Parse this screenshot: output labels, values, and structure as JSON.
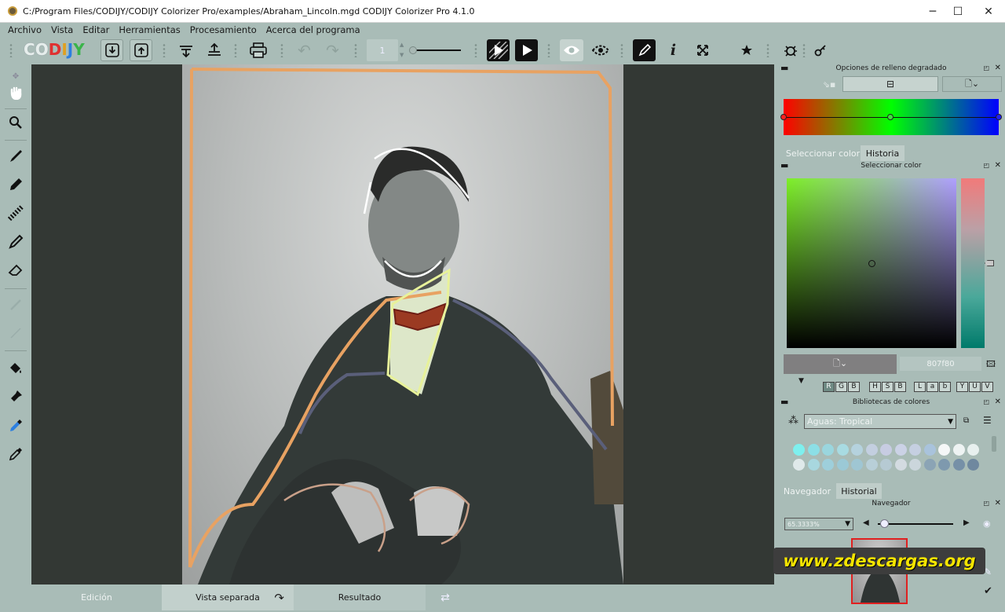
{
  "window": {
    "title": "C:/Program Files/CODIJY/CODIJY Colorizer Pro/examples/Abraham_Lincoln.mgd CODIJY Colorizer Pro 4.1.0",
    "minimize": "─",
    "maximize": "☐",
    "close": "✕"
  },
  "menu": [
    "Archivo",
    "Vista",
    "Editar",
    "Herramientas",
    "Procesamiento",
    "Acerca del programa"
  ],
  "toolbar": {
    "logo": [
      "C",
      "O",
      "D",
      "I",
      "J",
      "Y"
    ],
    "page_number": "1"
  },
  "bottom": {
    "edit": "Edición",
    "split": "Vista separada",
    "result": "Resultado"
  },
  "gradient_panel": {
    "title": "Opciones de relleno degradado"
  },
  "color_panel": {
    "tabs": [
      "Seleccionar color",
      "Historia"
    ],
    "title": "Seleccionar color",
    "hex": "807f80",
    "rgb": [
      "R",
      "G",
      "B"
    ],
    "hsb": [
      "H",
      "S",
      "B"
    ],
    "lab": [
      "L",
      "a",
      "b"
    ],
    "yuv": [
      "Y",
      "U",
      "V"
    ]
  },
  "libraries": {
    "title": "Bibliotecas de colores",
    "selected": "Aguas: Tropical",
    "swatches_row1": [
      "#7ef0ee",
      "#8cdfe6",
      "#9ad6de",
      "#a8dbe2",
      "#b5d2de",
      "#c3cfe0",
      "#c7cce2",
      "#cbd2e6",
      "#c5cfe1",
      "#a9c3dc",
      "#f5f7f7",
      "#eef3f3",
      "#e8f0ef"
    ],
    "swatches_row2": [
      "#dfe9ea",
      "#a8d7df",
      "#9ecfdb",
      "#9bc9d6",
      "#9fc6d3",
      "#b8cfd8",
      "#b6cad3",
      "#d3dbe1",
      "#cbd6dc",
      "#8ba4b5",
      "#7e99ae",
      "#7690a7",
      "#6f889f"
    ]
  },
  "navigator": {
    "tabs": [
      "Navegador",
      "Historial"
    ],
    "title": "Navegador",
    "zoom": "65.3333%"
  },
  "watermark": "www.zdescargas.org",
  "colors": {
    "bg": "#a9bcb7",
    "canvas": "#333834",
    "accent": "#e8a262"
  }
}
